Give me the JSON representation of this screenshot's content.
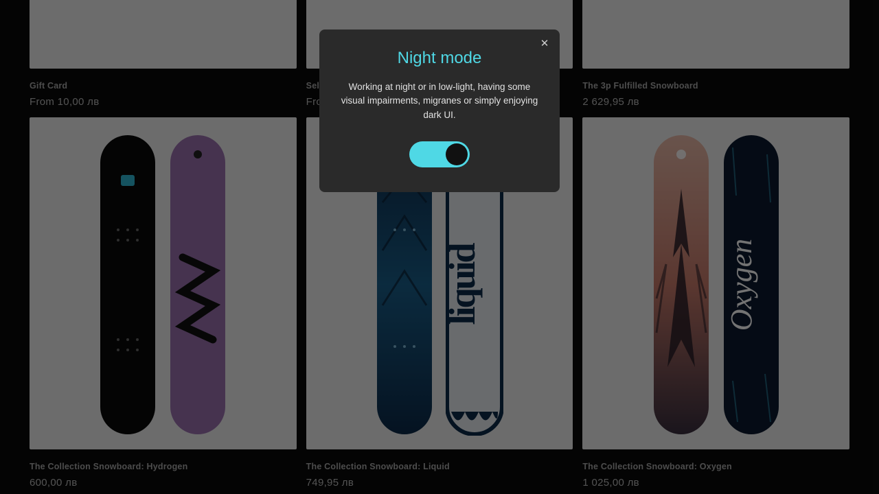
{
  "modal": {
    "title": "Night mode",
    "body": "Working at night or in low-light, having some visual impairments, migranes or simply enjoying dark UI.",
    "toggle_on": true
  },
  "products": [
    {
      "name": "Gift Card",
      "price": "From 10,00 лв"
    },
    {
      "name": "Sel",
      "price": "Fro"
    },
    {
      "name": "The 3p Fulfilled Snowboard",
      "price": "2 629,95 лв"
    },
    {
      "name": "The Collection Snowboard: Hydrogen",
      "price": "600,00 лв"
    },
    {
      "name": "The Collection Snowboard: Liquid",
      "price": "749,95 лв"
    },
    {
      "name": "The Collection Snowboard: Oxygen",
      "price": "1 025,00 лв"
    }
  ]
}
